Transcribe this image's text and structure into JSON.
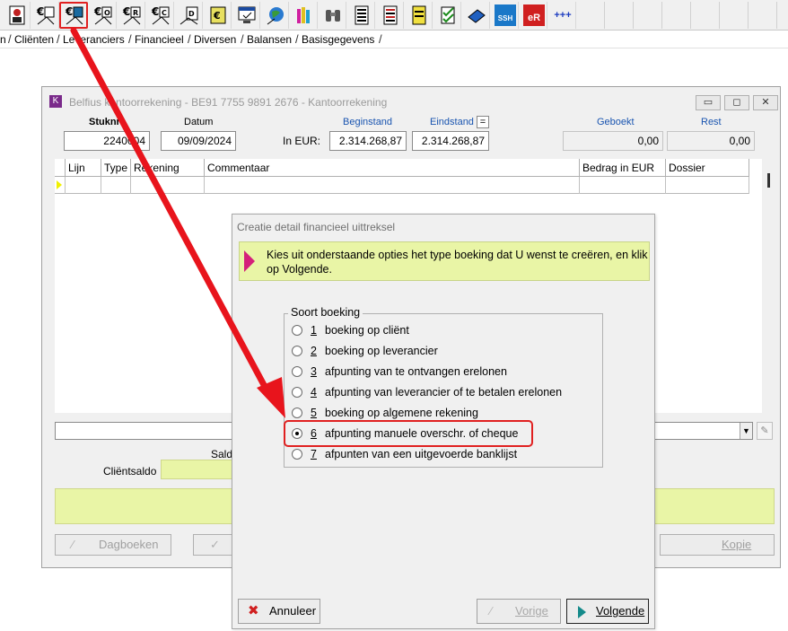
{
  "toolbar": {
    "icons": [
      "contact-card-icon",
      "euro-factuur-icon",
      "euro-folder-icon",
      "euro-offerte-icon",
      "euro-rapport-icon",
      "euro-creditnota-icon",
      "doc-icon",
      "euro-book-icon",
      "screen-check-icon",
      "globe-icon",
      "books-icon",
      "binoculars-icon",
      "list-icon",
      "red-list-icon",
      "yellow-note-icon",
      "check-list-icon",
      "blue-book-icon",
      "ssh-icon",
      "er-icon",
      "more-icon"
    ],
    "ssh_label": "SSH",
    "er_label": "eR",
    "more_label": "+++",
    "highlight_color": "#e02020"
  },
  "menu": {
    "tabs": [
      "n",
      "Cliënten",
      "Leveranciers",
      "Financieel",
      "Diversen",
      "Balansen",
      "Basisgegevens"
    ]
  },
  "window": {
    "title": "Belfius kantoorrekening - BE91 7755 9891 2676 - Kantoorrekening",
    "stuknr_label": "Stuknr",
    "stuknr_value": "2240004",
    "datum_label": "Datum",
    "datum_value": "09/09/2024",
    "in_eur_label": "In EUR:",
    "beginstand_label": "Beginstand",
    "beginstand_value": "2.314.268,87",
    "eindstand_label": "Eindstand",
    "eindstand_value": "2.314.268,87",
    "equals_label": "=",
    "geboekt_label": "Geboekt",
    "geboekt_value": "0,00",
    "rest_label": "Rest",
    "rest_value": "0,00",
    "columns": [
      "Lijn",
      "Type",
      "Rekening",
      "Commentaar",
      "Bedrag in EUR",
      "Dossier"
    ],
    "saldo_label": "Saldo",
    "clientsaldo_label": "Cliëntsaldo",
    "dagboeken_label": "Dagboeken",
    "kopie_label": "Kopie"
  },
  "dialog": {
    "title": "Creatie detail financieel uittreksel",
    "info": "Kies uit onderstaande opties het type boeking dat U wenst te creëren, en klik op Volgende.",
    "group_label": "Soort boeking",
    "options": [
      {
        "num": "1",
        "label": "boeking op cliënt"
      },
      {
        "num": "2",
        "label": "boeking op leverancier"
      },
      {
        "num": "3",
        "label": "afpunting van te ontvangen erelonen"
      },
      {
        "num": "4",
        "label": "afpunting van leverancier of te betalen erelonen"
      },
      {
        "num": "5",
        "label": "boeking op algemene rekening"
      },
      {
        "num": "6",
        "label": "afpunting manuele overschr. of cheque"
      },
      {
        "num": "7",
        "label": "afpunten van een uitgevoerde banklijst"
      }
    ],
    "selected_option": "6",
    "annuleer_label": "Annuleer",
    "vorige_label": "Vorige",
    "volgende_label": "Volgende"
  }
}
